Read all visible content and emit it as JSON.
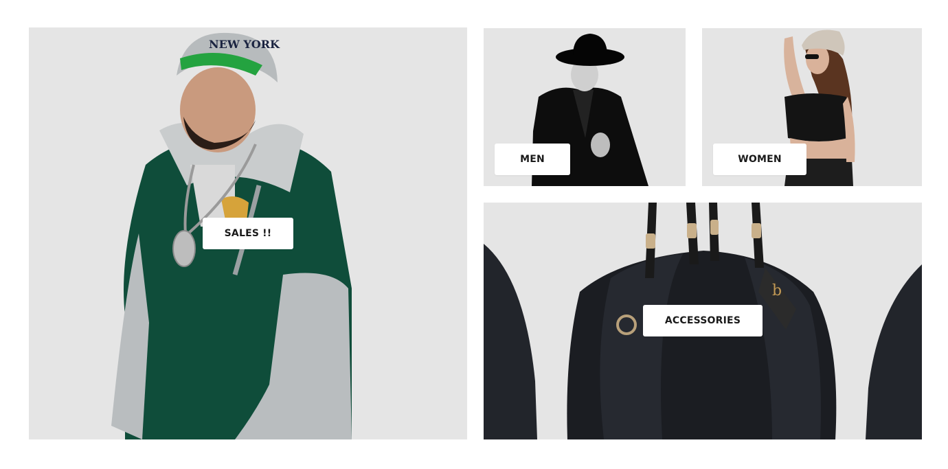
{
  "categories": {
    "sales": {
      "label": "SALES !!"
    },
    "men": {
      "label": "MEN"
    },
    "women": {
      "label": "WOMEN"
    },
    "accessories": {
      "label": "ACCESSORIES"
    }
  },
  "colors": {
    "tile_background": "#e5e5e5",
    "button_background": "#ffffff",
    "button_text": "#1a1a1a"
  },
  "images": {
    "sales": "man-in-green-hoodie-and-beanie",
    "men": "man-in-black-coat-and-hat",
    "women": "woman-in-crop-top-and-cap",
    "accessories": "black-leather-handbags"
  }
}
